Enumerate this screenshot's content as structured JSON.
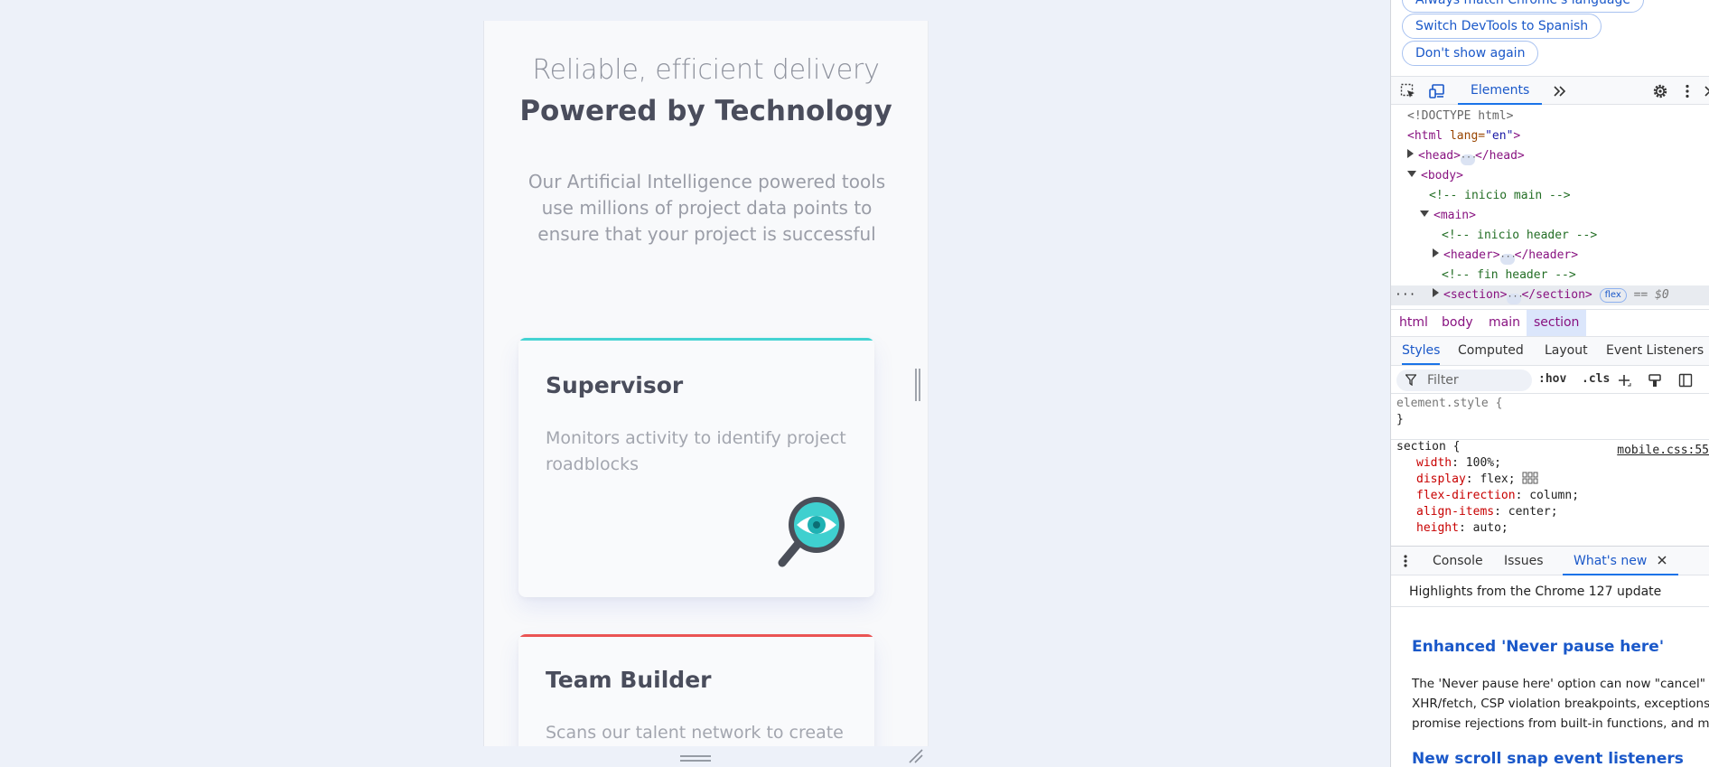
{
  "page": {
    "hero_thin": "Reliable, efficient delivery",
    "hero_bold": "Powered by Technology",
    "hero_desc": "Our Artificial Intelligence powered tools use millions of project data points to ensure that your project is successful",
    "cards": [
      {
        "title": "Supervisor",
        "desc": "Monitors activity to identify project roadblocks",
        "accent": "#44d3d2",
        "icon": "magnifier-eye-icon"
      },
      {
        "title": "Team Builder",
        "desc": "Scans our talent network to create",
        "accent": "#ea5454"
      }
    ]
  },
  "devtools": {
    "lang_pills": [
      "Always match Chrome's language",
      "Switch DevTools to Spanish",
      "Don't show again"
    ],
    "main_tab": "Elements",
    "dom": {
      "doctype": "<!DOCTYPE html>",
      "html_open": "<html",
      "lang_attr": " lang=",
      "lang_val": "\"en\"",
      "html_close_bracket": ">",
      "head_open": "<head>",
      "head_close": "</head>",
      "body_open": "<body>",
      "comment_main": "<!-- inicio main -->",
      "main_open": "<main>",
      "comment_header_start": "<!-- inicio header -->",
      "header_open": "<header>",
      "header_close": "</header>",
      "comment_header_end": "<!-- fin header -->",
      "section_open": "<section>",
      "section_close": "</section>",
      "flex_badge": "flex",
      "selected_ref": "== $0"
    },
    "breadcrumbs": [
      "html",
      "body",
      "main",
      "section"
    ],
    "styles_tabs": [
      "Styles",
      "Computed",
      "Layout",
      "Event Listeners"
    ],
    "filter_placeholder": "Filter",
    "hov": ":hov",
    "cls": ".cls",
    "element_style": "element.style {",
    "close_brace": "}",
    "section_rule": "section {",
    "source": "mobile.css:55",
    "declarations": [
      {
        "prop": "width",
        "val": "100%;"
      },
      {
        "prop": "display",
        "val": "flex;"
      },
      {
        "prop": "flex-direction",
        "val": "column;"
      },
      {
        "prop": "align-items",
        "val": "center;"
      },
      {
        "prop": "height",
        "val": "auto;"
      }
    ],
    "drawer_tabs": [
      "Console",
      "Issues",
      "What's new"
    ],
    "whats_new_header": "Highlights from the Chrome 127 update",
    "whats_new_title_1": "Enhanced 'Never pause here'",
    "whats_new_body": [
      "The 'Never pause here' option can now \"cancel\" D",
      "XHR/fetch, CSP violation breakpoints, exceptions a",
      "promise rejections from built-in functions, and mo"
    ],
    "whats_new_title_2": "New scroll snap event listeners"
  }
}
